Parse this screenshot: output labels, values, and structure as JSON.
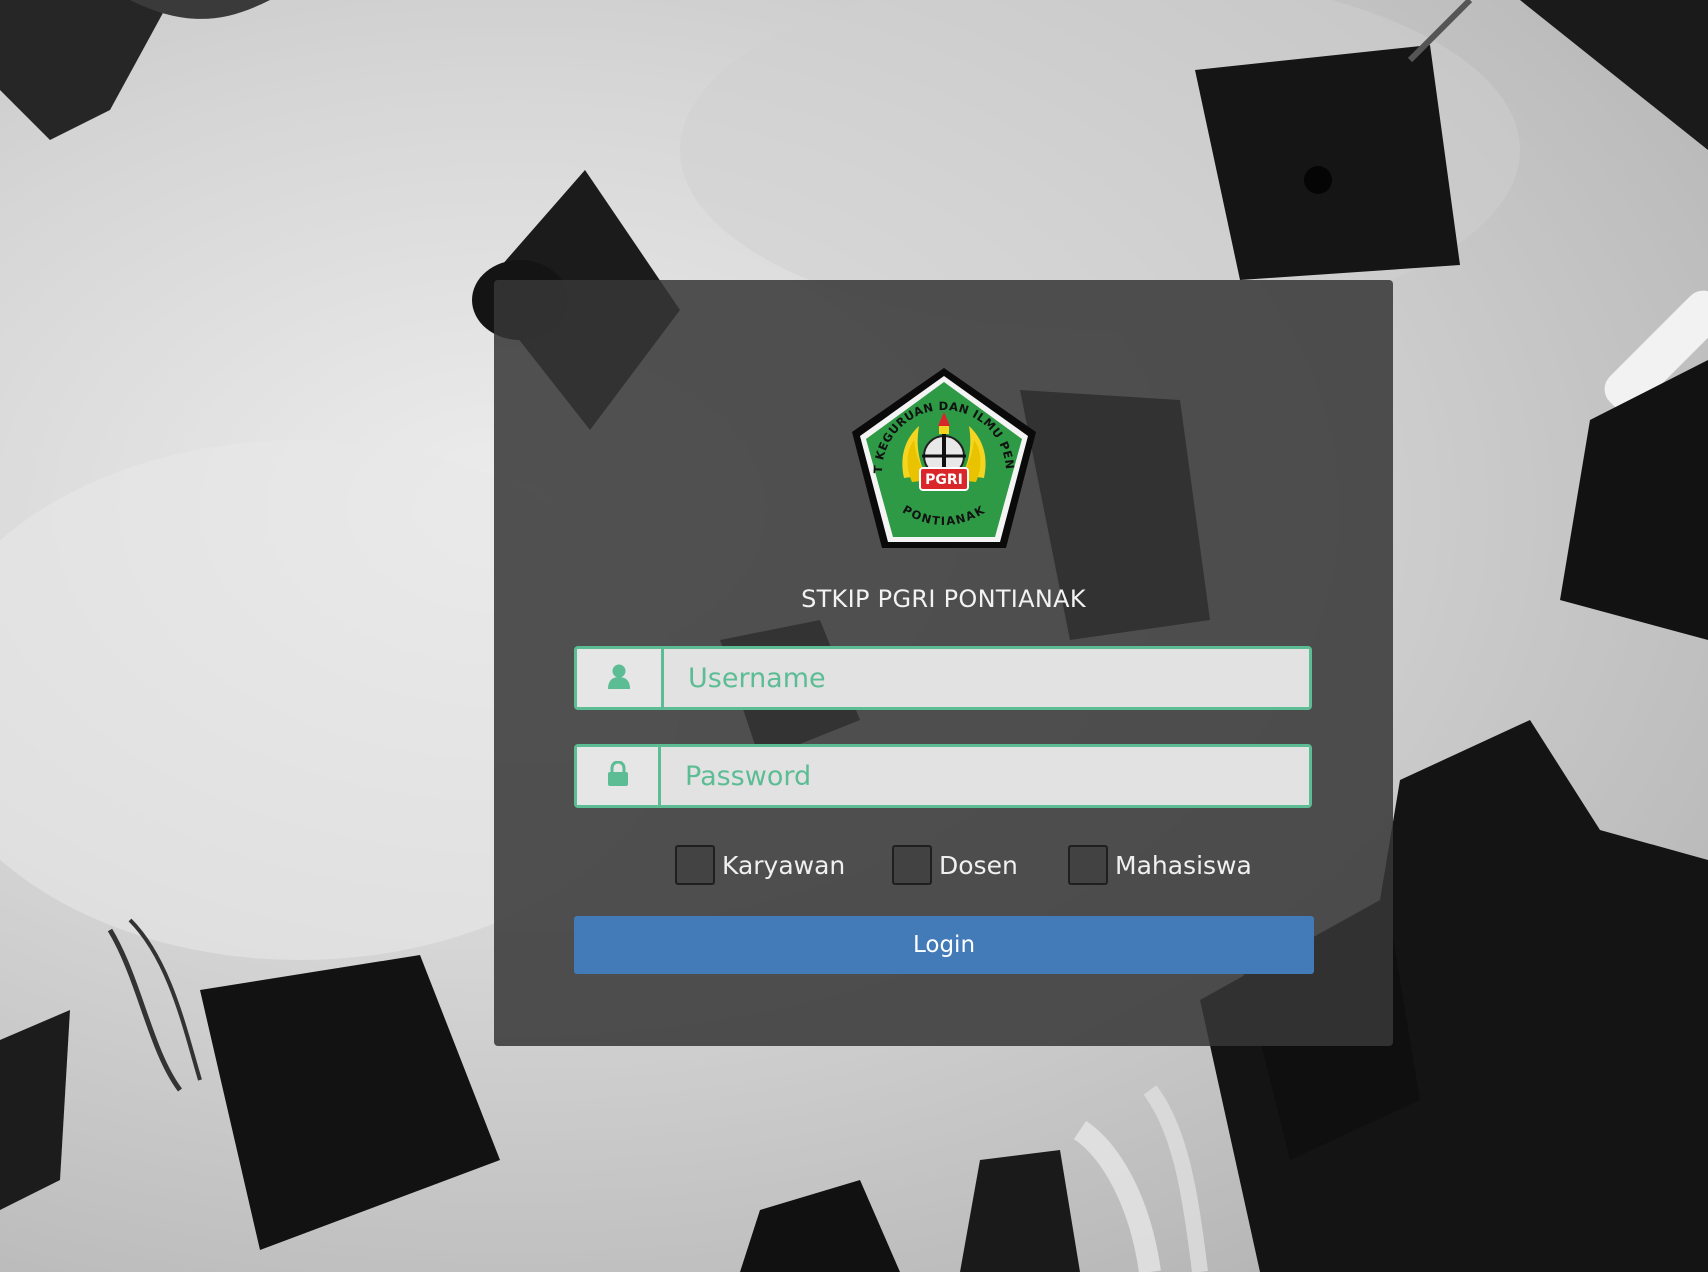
{
  "app": {
    "title": "STKIP PGRI PONTIANAK",
    "logo_icon": "pgri-pontianak-seal-logo",
    "logo_ring_text": "INSTITUT KEGURUAN DAN ILMU PENDIDIKAN",
    "logo_bottom_text": "PONTIANAK",
    "logo_badge_text": "PGRI"
  },
  "form": {
    "username": {
      "placeholder": "Username",
      "value": "",
      "icon": "user-icon"
    },
    "password": {
      "placeholder": "Password",
      "value": "",
      "icon": "lock-icon"
    },
    "roles": [
      {
        "label": "Karyawan",
        "checked": false
      },
      {
        "label": "Dosen",
        "checked": false
      },
      {
        "label": "Mahasiswa",
        "checked": false
      }
    ],
    "submit_label": "Login"
  },
  "colors": {
    "accent_green": "#5cbd94",
    "button_blue": "#437ab8",
    "panel": "#373737",
    "logo_green": "#2e9a45"
  }
}
